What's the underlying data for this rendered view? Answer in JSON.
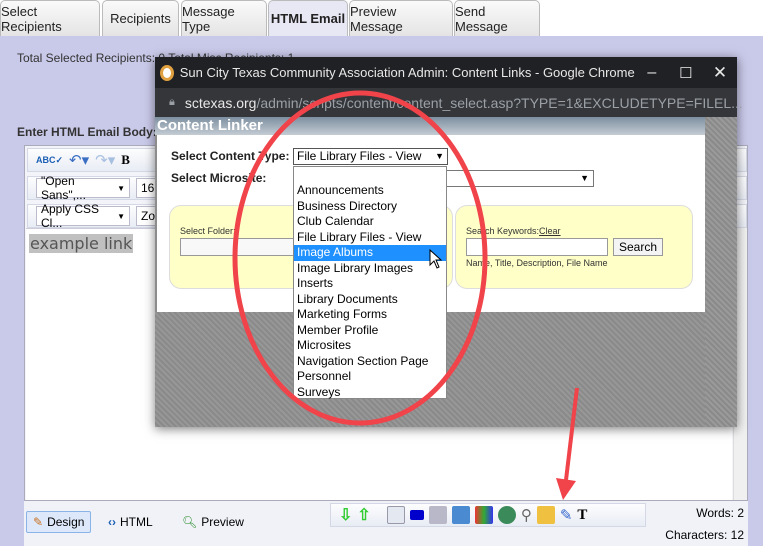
{
  "tabs": [
    {
      "label": "Select Recipients"
    },
    {
      "label": "Recipients"
    },
    {
      "label": "Message Type"
    },
    {
      "label": "HTML Email",
      "active": true
    },
    {
      "label": "Preview Message"
    },
    {
      "label": "Send Message"
    }
  ],
  "recipients_line": "Total Selected Recipients: 0   Total Misc Recipients: 1",
  "body_label": "Enter HTML Email Body:",
  "editor": {
    "font_select": "\"Open Sans\",...",
    "size_select": "16p",
    "css_select": "Apply CSS Cl...",
    "zoom_select": "Zoo",
    "content": "example link",
    "modes": {
      "design": "Design",
      "html": "HTML",
      "preview": "Preview"
    },
    "words": "Words: 2",
    "characters": "Characters: 12"
  },
  "popup": {
    "title": "Sun City Texas Community Association Admin: Content Links - Google Chrome",
    "url_domain": "sctexas.org",
    "url_path": "/admin/scripts/content/content_select.asp?TYPE=1&EXCLUDETYPE=FILEL...",
    "header": "Content Linker",
    "content_type_label": "Select Content Type:",
    "content_type_value": "File Library Files - View",
    "microsite_label": "Select Microsite:",
    "folder_label": "Select Folder:",
    "keywords_label": "Search Keywords:",
    "clear_link": "Clear",
    "search_button": "Search",
    "search_hint": "Name, Title, Description, File Name",
    "options": [
      "Announcements",
      "Business Directory",
      "Club Calendar",
      "File Library Files - View",
      "Image Albums",
      "Image Library Images",
      "Inserts",
      "Library Documents",
      "Marketing Forms",
      "Member Profile",
      "Microsites",
      "Navigation Section Page",
      "Personnel",
      "Surveys"
    ],
    "highlighted_option": "Image Albums"
  },
  "colors": {
    "annotation": "#f0434a",
    "highlight": "#1e90ff",
    "background": "#c9c9e9"
  }
}
